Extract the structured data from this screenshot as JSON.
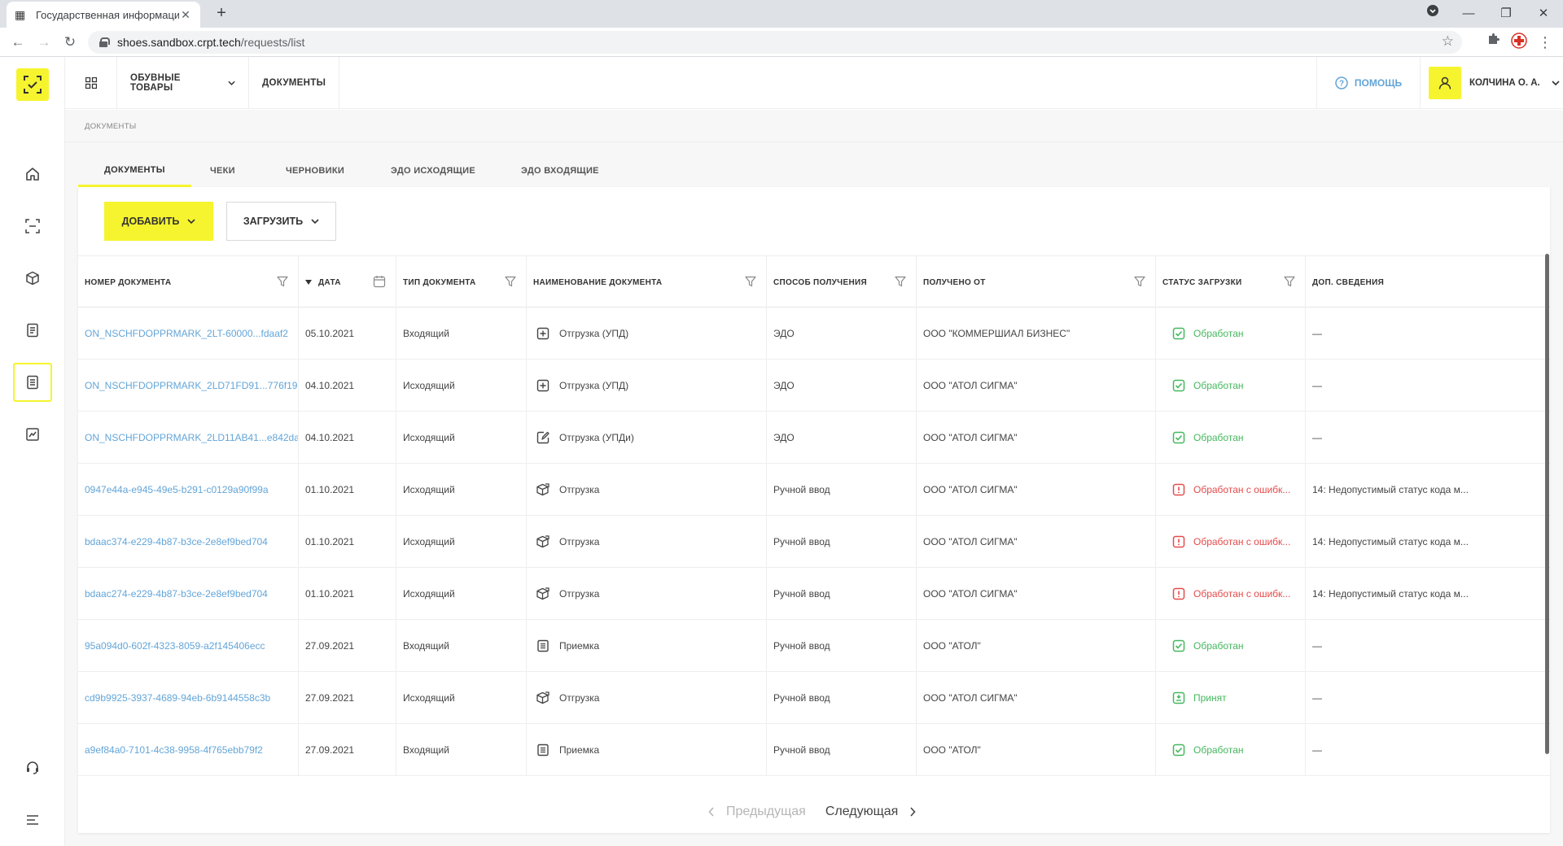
{
  "browser": {
    "tab_title": "Государственная информацион",
    "url_host": "shoes.sandbox.crpt.tech",
    "url_path": "/requests/list"
  },
  "topnav": {
    "category": "ОБУВНЫЕ ТОВАРЫ",
    "documents": "ДОКУМЕНТЫ",
    "help": "ПОМОЩЬ",
    "user": "КОЛЧИНА О. А."
  },
  "breadcrumb": "ДОКУМЕНТЫ",
  "tabs": [
    "ДОКУМЕНТЫ",
    "ЧЕКИ",
    "ЧЕРНОВИКИ",
    "ЭДО ИСХОДЯЩИЕ",
    "ЭДО ВХОДЯЩИЕ"
  ],
  "toolbar": {
    "add_label": "ДОБАВИТЬ",
    "upload_label": "ЗАГРУЗИТЬ"
  },
  "table": {
    "columns": [
      "НОМЕР ДОКУМЕНТА",
      "ДАТА",
      "ТИП ДОКУМЕНТА",
      "НАИМЕНОВАНИЕ ДОКУМЕНТА",
      "СПОСОБ ПОЛУЧЕНИЯ",
      "ПОЛУЧЕНО ОТ",
      "СТАТУС ЗАГРУЗКИ",
      "ДОП. СВЕДЕНИЯ"
    ],
    "rows": [
      {
        "number": "ON_NSCHFDOPPRMARK_2LT-60000...fdaaf2",
        "date": "05.10.2021",
        "type": "Входящий",
        "name": "Отгрузка (УПД)",
        "name_icon": "plus-square-icon",
        "method": "ЭДО",
        "from": "ООО \"КОММЕРШИАЛ БИЗНЕС\"",
        "status": "Обработан",
        "status_kind": "ok",
        "extra": "—"
      },
      {
        "number": "ON_NSCHFDOPPRMARK_2LD71FD91...776f19",
        "date": "04.10.2021",
        "type": "Исходящий",
        "name": "Отгрузка (УПД)",
        "name_icon": "plus-square-icon",
        "method": "ЭДО",
        "from": "ООО \"АТОЛ СИГМА\"",
        "status": "Обработан",
        "status_kind": "ok",
        "extra": "—"
      },
      {
        "number": "ON_NSCHFDOPPRMARK_2LD11AB41...e842da",
        "date": "04.10.2021",
        "type": "Исходящий",
        "name": "Отгрузка (УПДи)",
        "name_icon": "edit-doc-icon",
        "method": "ЭДО",
        "from": "ООО \"АТОЛ СИГМА\"",
        "status": "Обработан",
        "status_kind": "ok",
        "extra": "—"
      },
      {
        "number": "0947e44a-e945-49e5-b291-c0129a90f99a",
        "date": "01.10.2021",
        "type": "Исходящий",
        "name": "Отгрузка",
        "name_icon": "box-out-icon",
        "method": "Ручной ввод",
        "from": "ООО \"АТОЛ СИГМА\"",
        "status": "Обработан с ошибк...",
        "status_kind": "err",
        "extra": "14: Недопустимый статус кода м..."
      },
      {
        "number": "bdaac374-e229-4b87-b3ce-2e8ef9bed704",
        "date": "01.10.2021",
        "type": "Исходящий",
        "name": "Отгрузка",
        "name_icon": "box-out-icon",
        "method": "Ручной ввод",
        "from": "ООО \"АТОЛ СИГМА\"",
        "status": "Обработан с ошибк...",
        "status_kind": "err",
        "extra": "14: Недопустимый статус кода м..."
      },
      {
        "number": "bdaac274-e229-4b87-b3ce-2e8ef9bed704",
        "date": "01.10.2021",
        "type": "Исходящий",
        "name": "Отгрузка",
        "name_icon": "box-out-icon",
        "method": "Ручной ввод",
        "from": "ООО \"АТОЛ СИГМА\"",
        "status": "Обработан с ошибк...",
        "status_kind": "err",
        "extra": "14: Недопустимый статус кода м..."
      },
      {
        "number": "95a094d0-602f-4323-8059-a2f145406ecc",
        "date": "27.09.2021",
        "type": "Входящий",
        "name": "Приемка",
        "name_icon": "list-doc-icon",
        "method": "Ручной ввод",
        "from": "ООО \"АТОЛ\"",
        "status": "Обработан",
        "status_kind": "ok",
        "extra": "—"
      },
      {
        "number": "cd9b9925-3937-4689-94eb-6b9144558c3b",
        "date": "27.09.2021",
        "type": "Исходящий",
        "name": "Отгрузка",
        "name_icon": "box-out-icon",
        "method": "Ручной ввод",
        "from": "ООО \"АТОЛ СИГМА\"",
        "status": "Принят",
        "status_kind": "accepted",
        "extra": "—"
      },
      {
        "number": "a9ef84a0-7101-4c38-9958-4f765ebb79f2",
        "date": "27.09.2021",
        "type": "Входящий",
        "name": "Приемка",
        "name_icon": "list-doc-icon",
        "method": "Ручной ввод",
        "from": "ООО \"АТОЛ\"",
        "status": "Обработан",
        "status_kind": "ok",
        "extra": "—"
      }
    ]
  },
  "pager": {
    "prev": "Предыдущая",
    "next": "Следующая"
  },
  "colors": {
    "accent": "#f6f42e",
    "link": "#63a5d8",
    "ok": "#44b85e",
    "error": "#e54b4b"
  }
}
